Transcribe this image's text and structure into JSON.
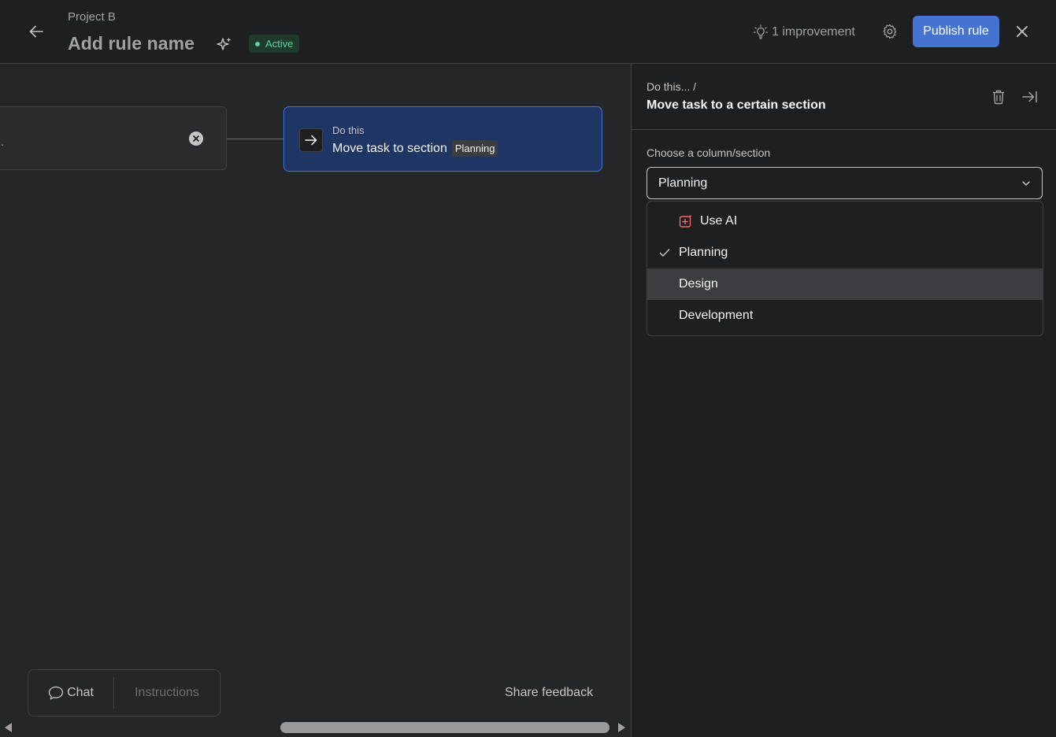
{
  "header": {
    "project_name": "Project B",
    "rule_name_placeholder": "Add rule name",
    "status": "Active",
    "improvements": "1 improvement",
    "publish_label": "Publish rule"
  },
  "canvas": {
    "trigger_text": ".",
    "action": {
      "caption": "Do this",
      "title": "Move task to section",
      "section_chip": "Planning"
    },
    "bottom": {
      "chat_label": "Chat",
      "instructions_label": "Instructions",
      "share_feedback": "Share feedback"
    }
  },
  "panel": {
    "breadcrumb": "Do this...  /",
    "title": "Move task to a certain section",
    "field_label": "Choose a column/section",
    "selected_value": "Planning",
    "options": [
      {
        "label": "Use AI",
        "icon": "ai-sparkle-icon",
        "selected": false,
        "hovered": false
      },
      {
        "label": "Planning",
        "icon": "",
        "selected": true,
        "hovered": false
      },
      {
        "label": "Design",
        "icon": "",
        "selected": false,
        "hovered": true
      },
      {
        "label": "Development",
        "icon": "",
        "selected": false,
        "hovered": false
      }
    ]
  },
  "colors": {
    "background": "#252628",
    "header": "#1e1f21",
    "accent_blue": "#4573d2",
    "action_card": "#1f3563",
    "active_green": "#5fd3a0",
    "ai_red": "#f06a6a"
  }
}
